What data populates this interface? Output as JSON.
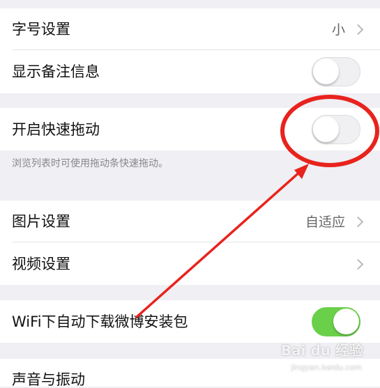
{
  "settings": {
    "font_size": {
      "label": "字号设置",
      "value": "小"
    },
    "show_remark": {
      "label": "显示备注信息",
      "enabled": false
    },
    "fast_drag": {
      "label": "开启快速拖动",
      "enabled": false,
      "description": "浏览列表时可使用拖动条快速拖动。"
    },
    "image_settings": {
      "label": "图片设置",
      "value": "自适应"
    },
    "video_settings": {
      "label": "视频设置"
    },
    "wifi_download": {
      "label": "WiFi下自动下载微博安装包",
      "enabled": true
    },
    "next_item": {
      "label": "声音与振动"
    }
  },
  "annotation": {
    "color": "#e8231d"
  },
  "watermark": {
    "text": "Bai du 经验",
    "sub": "jingyan.baidu.com"
  }
}
